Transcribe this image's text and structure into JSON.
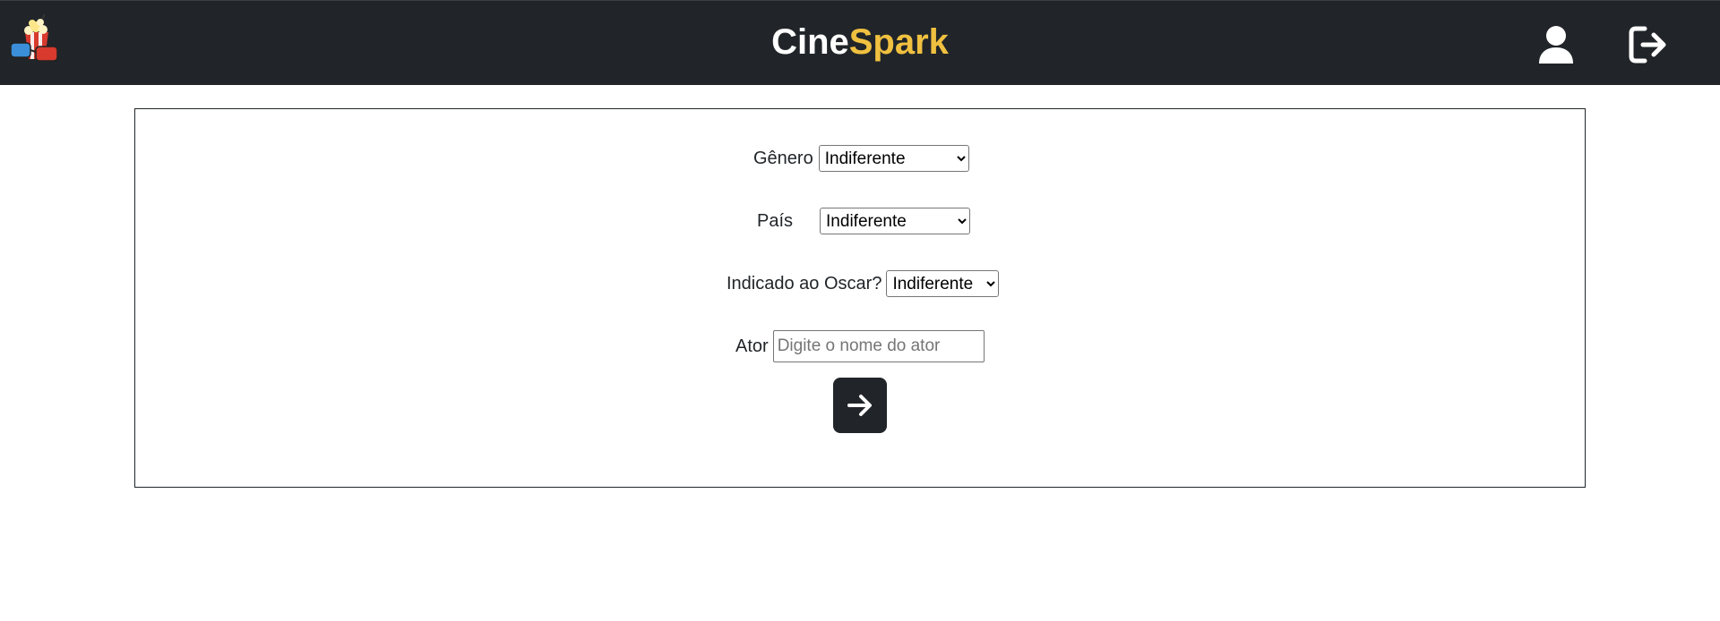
{
  "app": {
    "brand_part1": "Cine",
    "brand_part2": "Spark",
    "logo_icon": "popcorn-3d-glasses-icon",
    "user_icon": "user-icon",
    "logout_icon": "logout-icon",
    "colors": {
      "navbar": "#212529",
      "brand_accent": "#f0c040",
      "button": "#212529"
    }
  },
  "filters": {
    "genre": {
      "label": "Gênero",
      "selected": "Indiferente",
      "options": [
        "Indiferente"
      ]
    },
    "country": {
      "label": "País",
      "selected": "Indiferente",
      "options": [
        "Indiferente"
      ]
    },
    "oscar": {
      "label": "Indicado ao Oscar?",
      "selected": "Indiferente",
      "options": [
        "Indiferente"
      ]
    },
    "actor": {
      "label": "Ator",
      "value": "",
      "placeholder": "Digite o nome do ator"
    },
    "submit_icon": "arrow-right-icon"
  }
}
